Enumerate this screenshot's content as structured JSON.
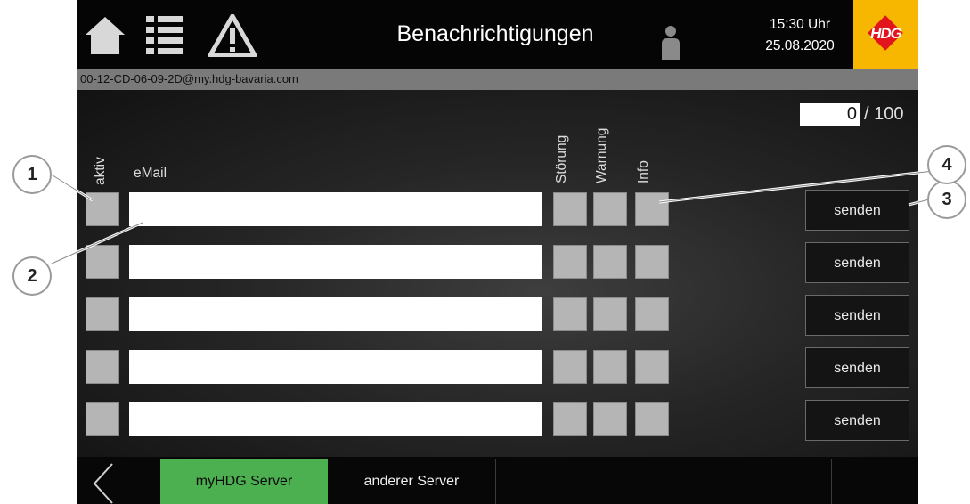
{
  "header": {
    "title": "Benachrichtigungen",
    "time": "15:30 Uhr",
    "date": "25.08.2020",
    "logo_text": "HDG",
    "icons": [
      "home-icon",
      "list-icon",
      "warning-icon",
      "user-icon"
    ]
  },
  "address": "00-12-CD-06-09-2D@my.hdg-bavaria.com",
  "counter": {
    "value": "0",
    "max": "/ 100"
  },
  "columns": {
    "active": "aktiv",
    "email": "eMail",
    "fault": "Störung",
    "warning": "Warnung",
    "info": "Info"
  },
  "rows": [
    {
      "email": "",
      "send": "senden"
    },
    {
      "email": "",
      "send": "senden"
    },
    {
      "email": "",
      "send": "senden"
    },
    {
      "email": "",
      "send": "senden"
    },
    {
      "email": "",
      "send": "senden"
    }
  ],
  "footer": {
    "tab_myhdg": "myHDG Server",
    "tab_other": "anderer Server",
    "back_icon": "chevron-left-icon"
  },
  "callouts": [
    "1",
    "2",
    "3",
    "4"
  ],
  "colors": {
    "header": "#050505",
    "address_bar": "#7a7a7a",
    "active_tab": "#4caf50",
    "logo_bg": "#f7b600",
    "logo_diamond": "#e2151d",
    "checkbox": "#b5b5b5"
  }
}
